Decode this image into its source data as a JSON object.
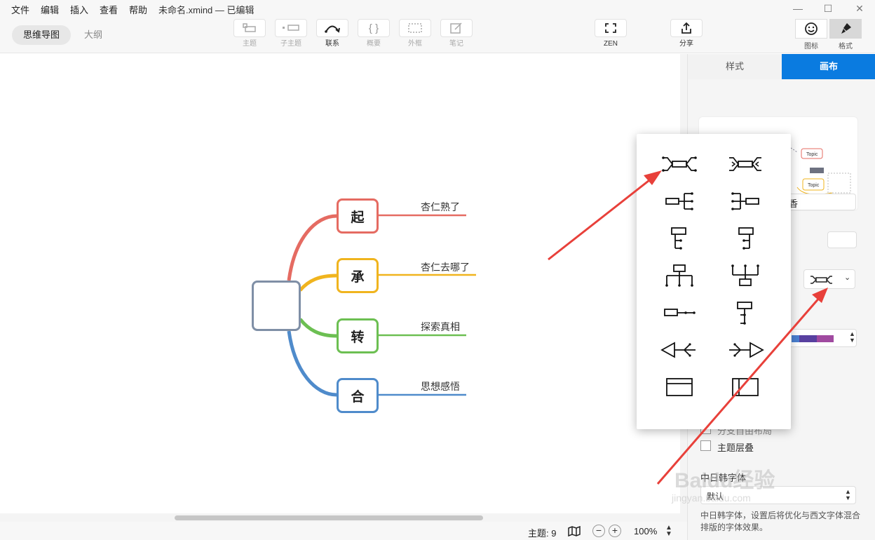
{
  "menu": {
    "items": [
      "文件",
      "编辑",
      "插入",
      "查看",
      "帮助"
    ],
    "window_title": "未命名.xmind — 已编辑"
  },
  "toolbar": {
    "view_tabs": [
      "思维导图",
      "大纲"
    ],
    "tools": [
      {
        "label": "主题",
        "icon": "topic-icon"
      },
      {
        "label": "子主题",
        "icon": "subtopic-icon"
      },
      {
        "label": "联系",
        "icon": "relationship-icon"
      },
      {
        "label": "概要",
        "icon": "summary-icon"
      },
      {
        "label": "外框",
        "icon": "boundary-icon"
      },
      {
        "label": "笔记",
        "icon": "note-icon"
      }
    ],
    "zen_label": "ZEN",
    "share_label": "分享",
    "icon_label": "图标",
    "format_label": "格式"
  },
  "mindmap": {
    "branches": [
      {
        "label": "起",
        "sub": "杏仁熟了",
        "color": "#e56b62"
      },
      {
        "label": "承",
        "sub": "杏仁去哪了",
        "color": "#f0b41e"
      },
      {
        "label": "转",
        "sub": "探索真相",
        "color": "#6cbf52"
      },
      {
        "label": "合",
        "sub": "思想感悟",
        "color": "#4f8bcb"
      }
    ]
  },
  "panel": {
    "tab_style": "样式",
    "tab_canvas": "画布",
    "preview_topic": "Topic",
    "partial_label": "香",
    "checkbox_partial": "分支自由布局",
    "checkbox_overlap": "主题层叠",
    "cjk_font_heading": "中日韩字体",
    "font_select": "默认",
    "font_desc": "中日韩字体，设置后将优化与西文字体混合排版的字体效果。"
  },
  "status": {
    "topic_count": "主题: 9",
    "zoom": "100%"
  },
  "watermark": "Baidu经验",
  "watermark_url": "jingyan.baidu.com"
}
